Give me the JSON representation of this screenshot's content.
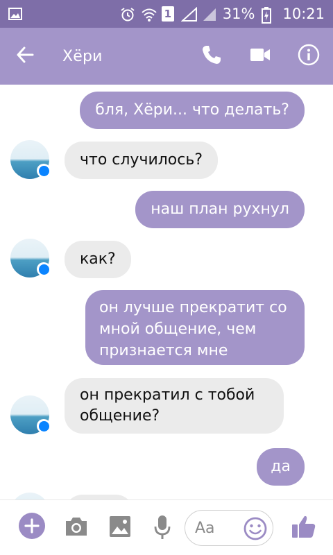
{
  "status_bar": {
    "battery": "31%",
    "time": "10:21",
    "sim_slot": "1",
    "icons": [
      "image-icon",
      "alarm-icon",
      "wifi-icon",
      "sim-icon",
      "signal-icon",
      "battery-charging-icon"
    ]
  },
  "header": {
    "title": "Хёри",
    "icons": [
      "back-arrow-icon",
      "phone-icon",
      "video-camera-icon",
      "info-icon"
    ]
  },
  "messages": [
    {
      "direction": "out",
      "text": "бля, Хёри... что делать?"
    },
    {
      "direction": "in",
      "text": "что случилось?"
    },
    {
      "direction": "out",
      "text": "наш план рухнул"
    },
    {
      "direction": "in",
      "text": "как?"
    },
    {
      "direction": "out",
      "text": "он лучше прекратит со мной общение, чем признается мне"
    },
    {
      "direction": "in",
      "text": "он прекратил с тобой общение?"
    },
    {
      "direction": "out",
      "text": "да"
    }
  ],
  "composer": {
    "placeholder": "Aa",
    "icons": [
      "plus-icon",
      "camera-icon",
      "gallery-icon",
      "microphone-icon",
      "emoji-icon",
      "thumbs-up-icon"
    ]
  },
  "colors": {
    "status_bar": "#7e6ea8",
    "header": "#a395c9",
    "outgoing_bubble": "#a395c9",
    "incoming_bubble": "#ebebeb",
    "accent": "#9b8bc4"
  }
}
